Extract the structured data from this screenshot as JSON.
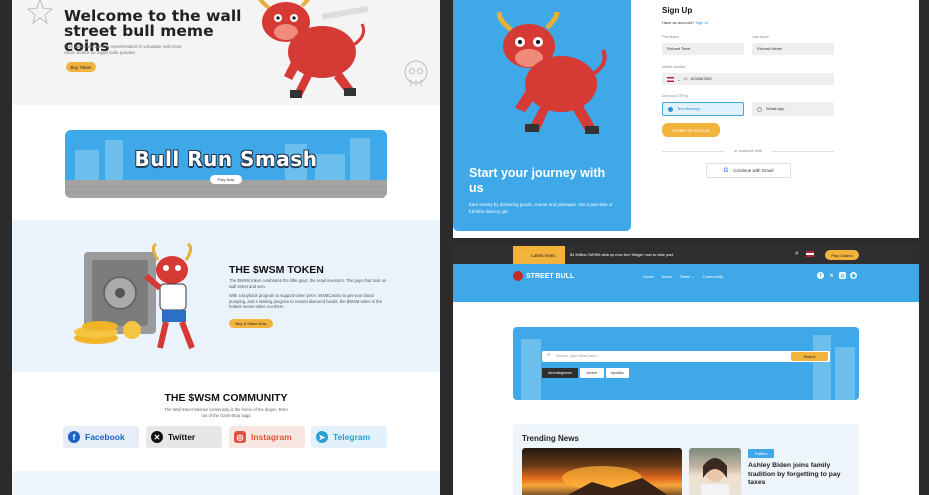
{
  "hero": {
    "title": "Welcome  to the wall street bull meme coins",
    "subtitle": "Duis aute irure dolor in reprehenderit in voluptate velit esse cillum dolore eu fugiat nulla pariatur.",
    "button": "Buy Token"
  },
  "game_banner": {
    "title": "Bull Run Smash",
    "button": "Play Now"
  },
  "token": {
    "title": "THE $WSM TOKEN",
    "p1": "The $WSM token celebrates the little guys, the retail investors. The guys that took on wall street and won.",
    "p2": "With a buyback program to support token price, WSMCasino to get your blood pumping, and a staking program to reward diamond hands, the $WSM token is the hottest meme token out there.",
    "button": "Buy & Stake Now"
  },
  "community": {
    "title": "THE $WSM COMMUNITY",
    "subtitle": "The Wall Street Memes community is the home of the degen. Born out of the GameStop saga",
    "links": [
      {
        "label": "Facebook",
        "icon": "facebook-icon"
      },
      {
        "label": "Twitter",
        "icon": "x-icon"
      },
      {
        "label": "Instagram",
        "icon": "instagram-icon"
      },
      {
        "label": "Telegram",
        "icon": "telegram-icon"
      }
    ]
  },
  "signup": {
    "panel_title": "Start  your journey with us",
    "panel_subtitle": "Earn money by delivering goods, courier and packages. Get a part time or full time delivery job",
    "title": "Sign Up",
    "have_account": "Have an account?",
    "sign_in": "Sign In",
    "first_name_label": "First Name",
    "first_name_value": "Richard Timer",
    "last_name_label": "Last Name",
    "last_name_value": "Richard Weber",
    "mobile_label": "Mobile Number",
    "mobile_code": "+1",
    "mobile_value": "8234567890",
    "otp_label": "Get your OTP by",
    "otp_text": "Text Message",
    "otp_whatsapp": "Whats App",
    "create_button": "Create an Account",
    "or_text": "or continue with",
    "gmail_button": "Continue with Gmail"
  },
  "news": {
    "ticker_tag": "Latest news",
    "ticker_text": "$1 Million SWSM airdrop now live! Wager now to take part.",
    "play_button": "Play Casino",
    "logo": "STREET BULL",
    "menu": [
      "Home",
      "News",
      "Token",
      "Community"
    ],
    "search_placeholder": "Search, type News here...",
    "search_button": "Search",
    "tags": [
      "#trendingnews",
      "#crime",
      "#politics"
    ],
    "trending_title": "Trending News",
    "article_tag": "Politics",
    "headline": "Ashley Biden joins family tradition by forgetting to pay taxes"
  },
  "colors": {
    "accent_blue": "#3ea8e8",
    "accent_yellow": "#f2b33d",
    "bull_red": "#d63a35"
  }
}
